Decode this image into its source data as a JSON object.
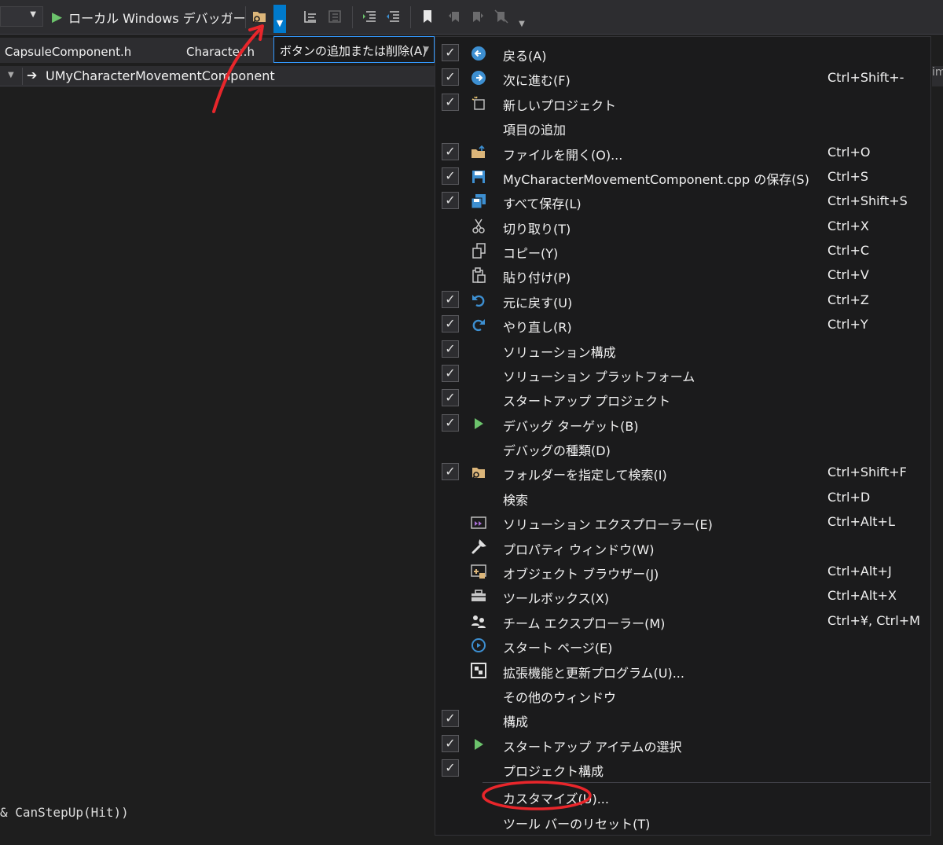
{
  "toolbar": {
    "run_label": "ローカル Windows デバッガー",
    "icons": [
      "find-in-files-icon",
      "toolbar-overflow-icon",
      "comment-icon",
      "uncomment-icon",
      "indent-icon",
      "outdent-icon",
      "bookmark-icon",
      "prev-bookmark-icon",
      "next-bookmark-icon",
      "clear-bookmarks-icon"
    ]
  },
  "tabs": [
    "CapsuleComponent.h",
    "Character.h"
  ],
  "navbar": {
    "member": "UMyCharacterMovementComponent"
  },
  "add_remove_button": {
    "label": "ボタンの追加または削除(A)"
  },
  "menu": {
    "items": [
      {
        "checked": true,
        "icon": "back-arrow-icon",
        "label": "戻る(A)",
        "shortcut": ""
      },
      {
        "checked": true,
        "icon": "forward-arrow-icon",
        "label": "次に進む(F)",
        "shortcut": "Ctrl+Shift+-"
      },
      {
        "checked": true,
        "icon": "new-project-icon",
        "label": "新しいプロジェクト",
        "shortcut": ""
      },
      {
        "checked": false,
        "icon": "",
        "label": "項目の追加",
        "shortcut": ""
      },
      {
        "checked": true,
        "icon": "open-file-icon",
        "label": "ファイルを開く(O)...",
        "shortcut": "Ctrl+O"
      },
      {
        "checked": true,
        "icon": "save-icon",
        "label": "MyCharacterMovementComponent.cpp の保存(S)",
        "shortcut": "Ctrl+S"
      },
      {
        "checked": true,
        "icon": "save-all-icon",
        "label": "すべて保存(L)",
        "shortcut": "Ctrl+Shift+S"
      },
      {
        "checked": false,
        "icon": "cut-icon",
        "label": "切り取り(T)",
        "shortcut": "Ctrl+X"
      },
      {
        "checked": false,
        "icon": "copy-icon",
        "label": "コピー(Y)",
        "shortcut": "Ctrl+C"
      },
      {
        "checked": false,
        "icon": "paste-icon",
        "label": "貼り付け(P)",
        "shortcut": "Ctrl+V"
      },
      {
        "checked": true,
        "icon": "undo-icon",
        "label": "元に戻す(U)",
        "shortcut": "Ctrl+Z"
      },
      {
        "checked": true,
        "icon": "redo-icon",
        "label": "やり直し(R)",
        "shortcut": "Ctrl+Y"
      },
      {
        "checked": true,
        "icon": "",
        "label": "ソリューション構成",
        "shortcut": ""
      },
      {
        "checked": true,
        "icon": "",
        "label": "ソリューション プラットフォーム",
        "shortcut": ""
      },
      {
        "checked": true,
        "icon": "",
        "label": "スタートアップ プロジェクト",
        "shortcut": ""
      },
      {
        "checked": true,
        "icon": "play-icon",
        "label": "デバッグ ターゲット(B)",
        "shortcut": ""
      },
      {
        "checked": false,
        "icon": "",
        "label": "デバッグの種類(D)",
        "shortcut": ""
      },
      {
        "checked": true,
        "icon": "find-in-files-icon",
        "label": "フォルダーを指定して検索(I)",
        "shortcut": "Ctrl+Shift+F"
      },
      {
        "checked": false,
        "icon": "",
        "label": "検索",
        "shortcut": "Ctrl+D"
      },
      {
        "checked": false,
        "icon": "solution-explorer-icon",
        "label": "ソリューション エクスプローラー(E)",
        "shortcut": "Ctrl+Alt+L"
      },
      {
        "checked": false,
        "icon": "wrench-icon",
        "label": "プロパティ ウィンドウ(W)",
        "shortcut": ""
      },
      {
        "checked": false,
        "icon": "object-browser-icon",
        "label": "オブジェクト ブラウザー(J)",
        "shortcut": "Ctrl+Alt+J"
      },
      {
        "checked": false,
        "icon": "toolbox-icon",
        "label": "ツールボックス(X)",
        "shortcut": "Ctrl+Alt+X"
      },
      {
        "checked": false,
        "icon": "team-explorer-icon",
        "label": "チーム エクスプローラー(M)",
        "shortcut": "Ctrl+¥, Ctrl+M"
      },
      {
        "checked": false,
        "icon": "start-page-icon",
        "label": "スタート ページ(E)",
        "shortcut": ""
      },
      {
        "checked": false,
        "icon": "extensions-icon",
        "label": "拡張機能と更新プログラム(U)...",
        "shortcut": ""
      },
      {
        "checked": false,
        "icon": "",
        "label": "その他のウィンドウ",
        "shortcut": ""
      },
      {
        "checked": true,
        "icon": "",
        "label": "構成",
        "shortcut": ""
      },
      {
        "checked": true,
        "icon": "play-icon",
        "label": "スタートアップ アイテムの選択",
        "shortcut": ""
      },
      {
        "checked": true,
        "icon": "",
        "label": "プロジェクト構成",
        "shortcut": ""
      },
      {
        "checked": false,
        "icon": "",
        "label": "カスタマイズ(U)...",
        "shortcut": ""
      },
      {
        "checked": false,
        "icon": "",
        "label": "ツール バーのリセット(T)",
        "shortcut": ""
      }
    ]
  },
  "code": {
    "line": "& CanStepUp(Hit))"
  },
  "colors": {
    "accent": "#007acc",
    "annotation": "#e8262b",
    "menu_bg": "#1b1b1c"
  }
}
